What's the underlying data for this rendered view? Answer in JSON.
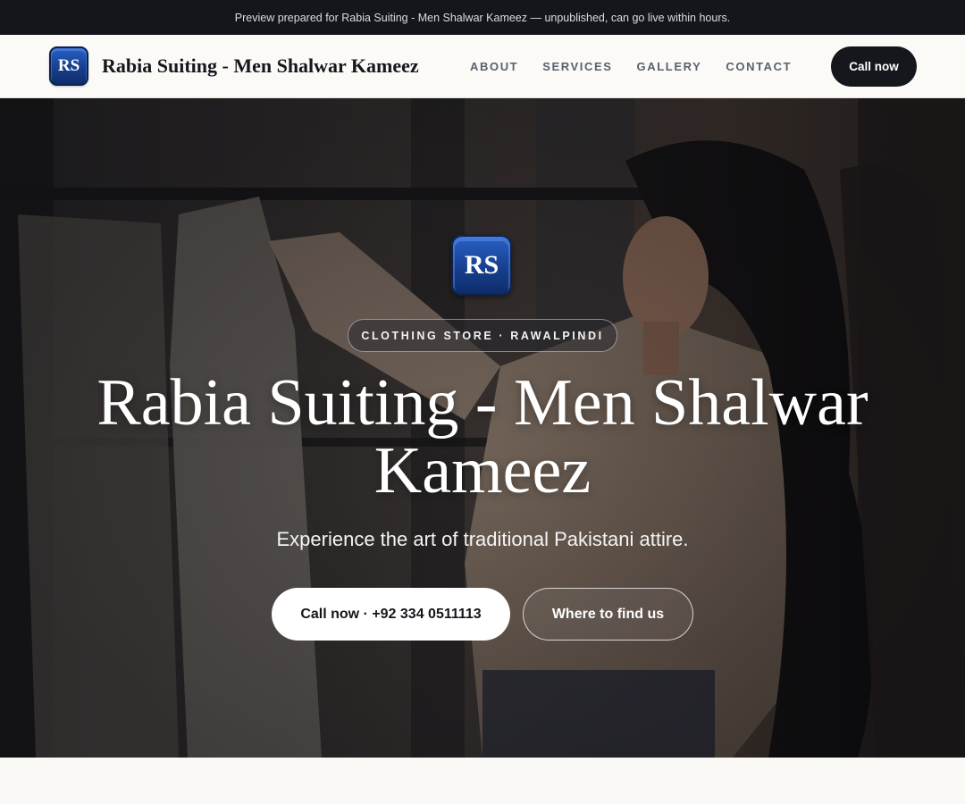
{
  "preview_bar": {
    "text": "Preview prepared for Rabia Suiting - Men Shalwar Kameez — unpublished, can go live within hours."
  },
  "nav": {
    "logo_text": "RS",
    "brand_name": "Rabia Suiting - Men Shalwar Kameez",
    "links": [
      {
        "label": "ABOUT"
      },
      {
        "label": "SERVICES"
      },
      {
        "label": "GALLERY"
      },
      {
        "label": "CONTACT"
      }
    ],
    "cta_label": "Call now"
  },
  "hero": {
    "logo_text": "RS",
    "badge": "CLOTHING STORE · RAWALPINDI",
    "title": "Rabia Suiting - Men Shalwar Kameez",
    "subtitle": "Experience the art of traditional Pakistani attire.",
    "primary_button": "Call now · +92 334 0511113",
    "secondary_button": "Where to find us"
  },
  "colors": {
    "dark": "#15171c",
    "logo_blue": "#173f8f",
    "page_bg": "#faf9f6"
  }
}
